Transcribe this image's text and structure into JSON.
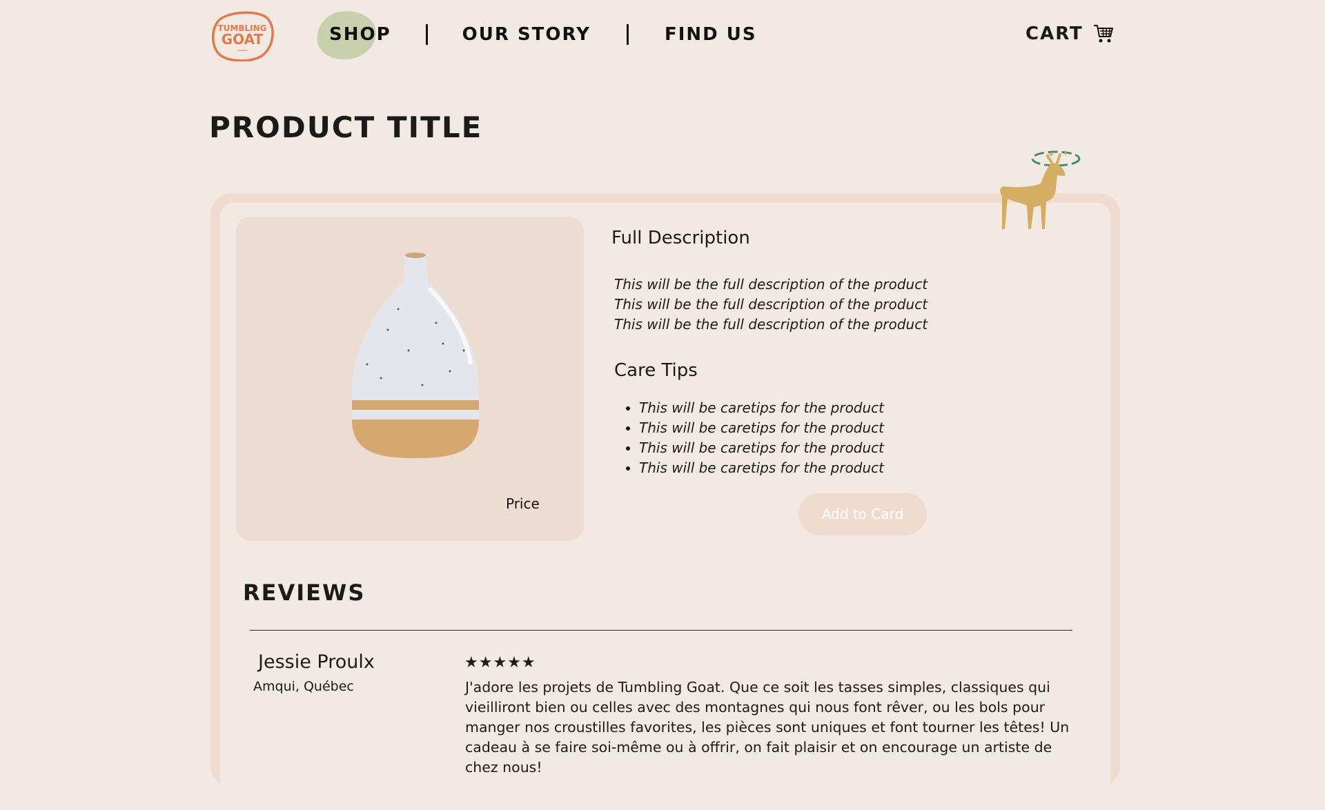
{
  "header": {
    "logo_text": [
      "TUMBLING",
      "GOAT"
    ],
    "nav": [
      "SHOP",
      "OUR STORY",
      "FIND US"
    ],
    "active_nav": "SHOP",
    "cart_label": "CART"
  },
  "product": {
    "title": "PRODUCT TITLE",
    "price_label": "Price",
    "description_heading": "Full Description",
    "description_lines": [
      "This will be the full description of the product",
      "This will be the full description of the product",
      "This will be the full description of the product"
    ],
    "care_heading": "Care Tips",
    "care_tips": [
      "This will be caretips for the product",
      "This will be caretips for the product",
      "This will be caretips for the product",
      "This will be caretips for the product"
    ],
    "add_button": "Add to Card"
  },
  "reviews": {
    "heading": "REVIEWS",
    "items": [
      {
        "name": "Jessie Proulx",
        "location": "Amqui, Québec",
        "stars": "★★★★★",
        "rating": 5,
        "text": "J'adore les projets de Tumbling Goat. Que ce soit les tasses simples, classiques qui vieilliront bien ou celles avec des montagnes qui nous font rêver, ou les bols pour manger nos croustilles favorites, les pièces sont uniques et font tourner les têtes! Un cadeau à se faire soi-même ou à offrir, on fait plaisir et on encourage un artiste de chez nous!"
      }
    ]
  },
  "colors": {
    "background": "#f2eae2",
    "card_border": "#f0dbd1",
    "shop_highlight": "#c8d0ad",
    "logo_orange": "#e07a4a",
    "goat_gold": "#d4ad64",
    "goat_halo_green": "#4a8a6a"
  },
  "icons": {
    "cart": "shopping-cart-icon",
    "mascot": "goat-mascot-icon"
  }
}
